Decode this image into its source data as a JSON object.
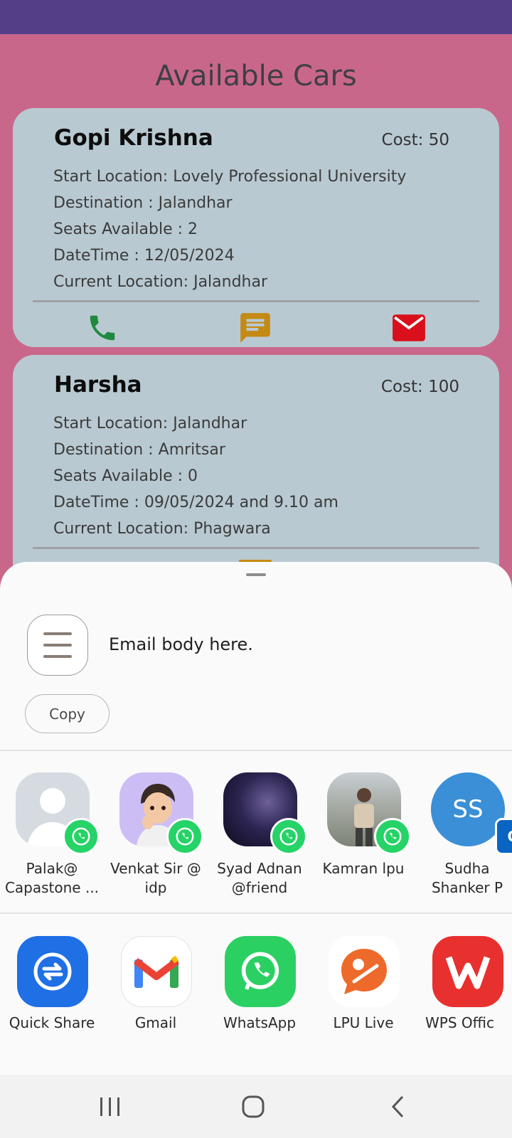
{
  "screen": {
    "title": "Available Cars"
  },
  "cars": [
    {
      "name": "Gopi Krishna",
      "cost": "Cost: 50",
      "start": "Start Location: Lovely Professional University",
      "destination": "Destination : Jalandhar",
      "seats": "Seats Available : 2",
      "datetime": "DateTime : 12/05/2024",
      "current": "Current Location: Jalandhar"
    },
    {
      "name": "Harsha",
      "cost": "Cost: 100",
      "start": "Start Location: Jalandhar",
      "destination": "Destination : Amritsar",
      "seats": "Seats Available : 0",
      "datetime": "DateTime : 09/05/2024 and 9.10 am",
      "current": "Current Location: Phagwara"
    }
  ],
  "card_actions": {
    "icons": [
      "phone-icon",
      "message-icon",
      "mail-icon"
    ]
  },
  "share_sheet": {
    "preview_text": "Email body here.",
    "copy_label": "Copy",
    "contacts": [
      {
        "name": "Palak@\nCapastone ...",
        "badge": "whatsapp-icon"
      },
      {
        "name": "Venkat Sir @\nidp",
        "badge": "whatsapp-icon"
      },
      {
        "name": "Syad Adnan\n@friend",
        "badge": "whatsapp-icon"
      },
      {
        "name": "Kamran lpu",
        "badge": "whatsapp-icon"
      },
      {
        "name": "Sudha\nShanker  P",
        "initials": "SS",
        "badge": "outlook-icon"
      }
    ],
    "apps": [
      {
        "label": "Quick Share"
      },
      {
        "label": "Gmail"
      },
      {
        "label": "WhatsApp"
      },
      {
        "label": "LPU Live"
      },
      {
        "label": "WPS Offic"
      }
    ]
  },
  "colors": {
    "status_bar": "#533f88",
    "background": "#c9678a",
    "card": "#b9c9d1",
    "call": "#1f8a3d",
    "message": "#c48a14",
    "mail": "#d9101b",
    "whatsapp": "#25d366"
  }
}
